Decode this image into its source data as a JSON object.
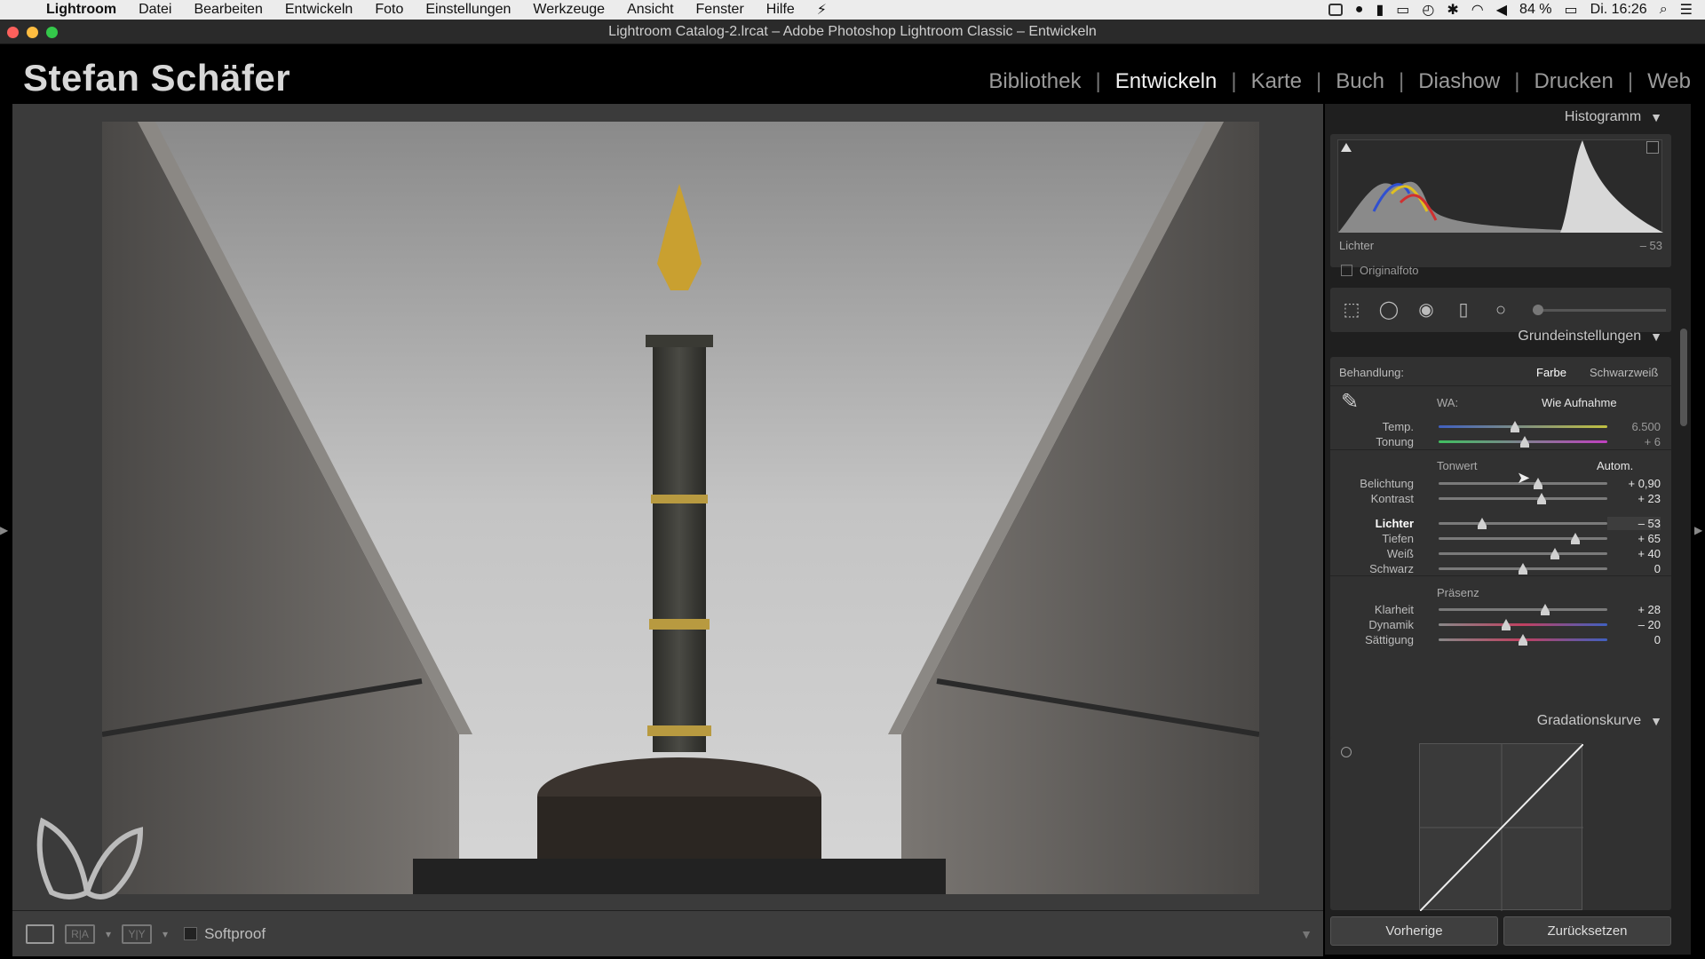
{
  "menubar": {
    "app": "Lightroom",
    "items": [
      "Datei",
      "Bearbeiten",
      "Entwickeln",
      "Foto",
      "Einstellungen",
      "Werkzeuge",
      "Ansicht",
      "Fenster",
      "Hilfe"
    ],
    "battery": "84 %",
    "clock": "Di. 16:26"
  },
  "window": {
    "title": "Lightroom Catalog-2.lrcat – Adobe Photoshop Lightroom Classic – Entwickeln"
  },
  "identity_plate": "Stefan Schäfer",
  "modules": [
    {
      "label": "Bibliothek",
      "active": false
    },
    {
      "label": "Entwickeln",
      "active": true
    },
    {
      "label": "Karte",
      "active": false
    },
    {
      "label": "Buch",
      "active": false
    },
    {
      "label": "Diashow",
      "active": false
    },
    {
      "label": "Drucken",
      "active": false
    },
    {
      "label": "Web",
      "active": false
    }
  ],
  "toolbar": {
    "softproof": "Softproof"
  },
  "histogram": {
    "header": "Histogramm",
    "label": "Lichter",
    "value": "– 53",
    "original": "Originalfoto"
  },
  "basic": {
    "header": "Grundeinstellungen",
    "treatment_label": "Behandlung:",
    "treatment_color": "Farbe",
    "treatment_bw": "Schwarzweiß",
    "wb_label": "WA:",
    "wb_value": "Wie Aufnahme",
    "wb_sliders": [
      {
        "label": "Temp.",
        "value": "6.500",
        "pos": 0.45,
        "dim": true
      },
      {
        "label": "Tonung",
        "value": "+ 6",
        "pos": 0.51,
        "dim": true
      }
    ],
    "tone_label": "Tonwert",
    "auto": "Autom.",
    "tone_sliders": [
      {
        "label": "Belichtung",
        "value": "+ 0,90",
        "pos": 0.59
      },
      {
        "label": "Kontrast",
        "value": "+ 23",
        "pos": 0.61
      }
    ],
    "tone2_sliders": [
      {
        "label": "Lichter",
        "value": "– 53",
        "pos": 0.26,
        "bold": true
      },
      {
        "label": "Tiefen",
        "value": "+ 65",
        "pos": 0.81
      },
      {
        "label": "Weiß",
        "value": "+ 40",
        "pos": 0.69
      },
      {
        "label": "Schwarz",
        "value": "0",
        "pos": 0.5
      }
    ],
    "presence_label": "Präsenz",
    "presence_sliders": [
      {
        "label": "Klarheit",
        "value": "+ 28",
        "pos": 0.63
      },
      {
        "label": "Dynamik",
        "value": "– 20",
        "pos": 0.4
      },
      {
        "label": "Sättigung",
        "value": "0",
        "pos": 0.5
      }
    ]
  },
  "curve": {
    "header": "Gradationskurve"
  },
  "buttons": {
    "previous": "Vorherige",
    "reset": "Zurücksetzen"
  }
}
